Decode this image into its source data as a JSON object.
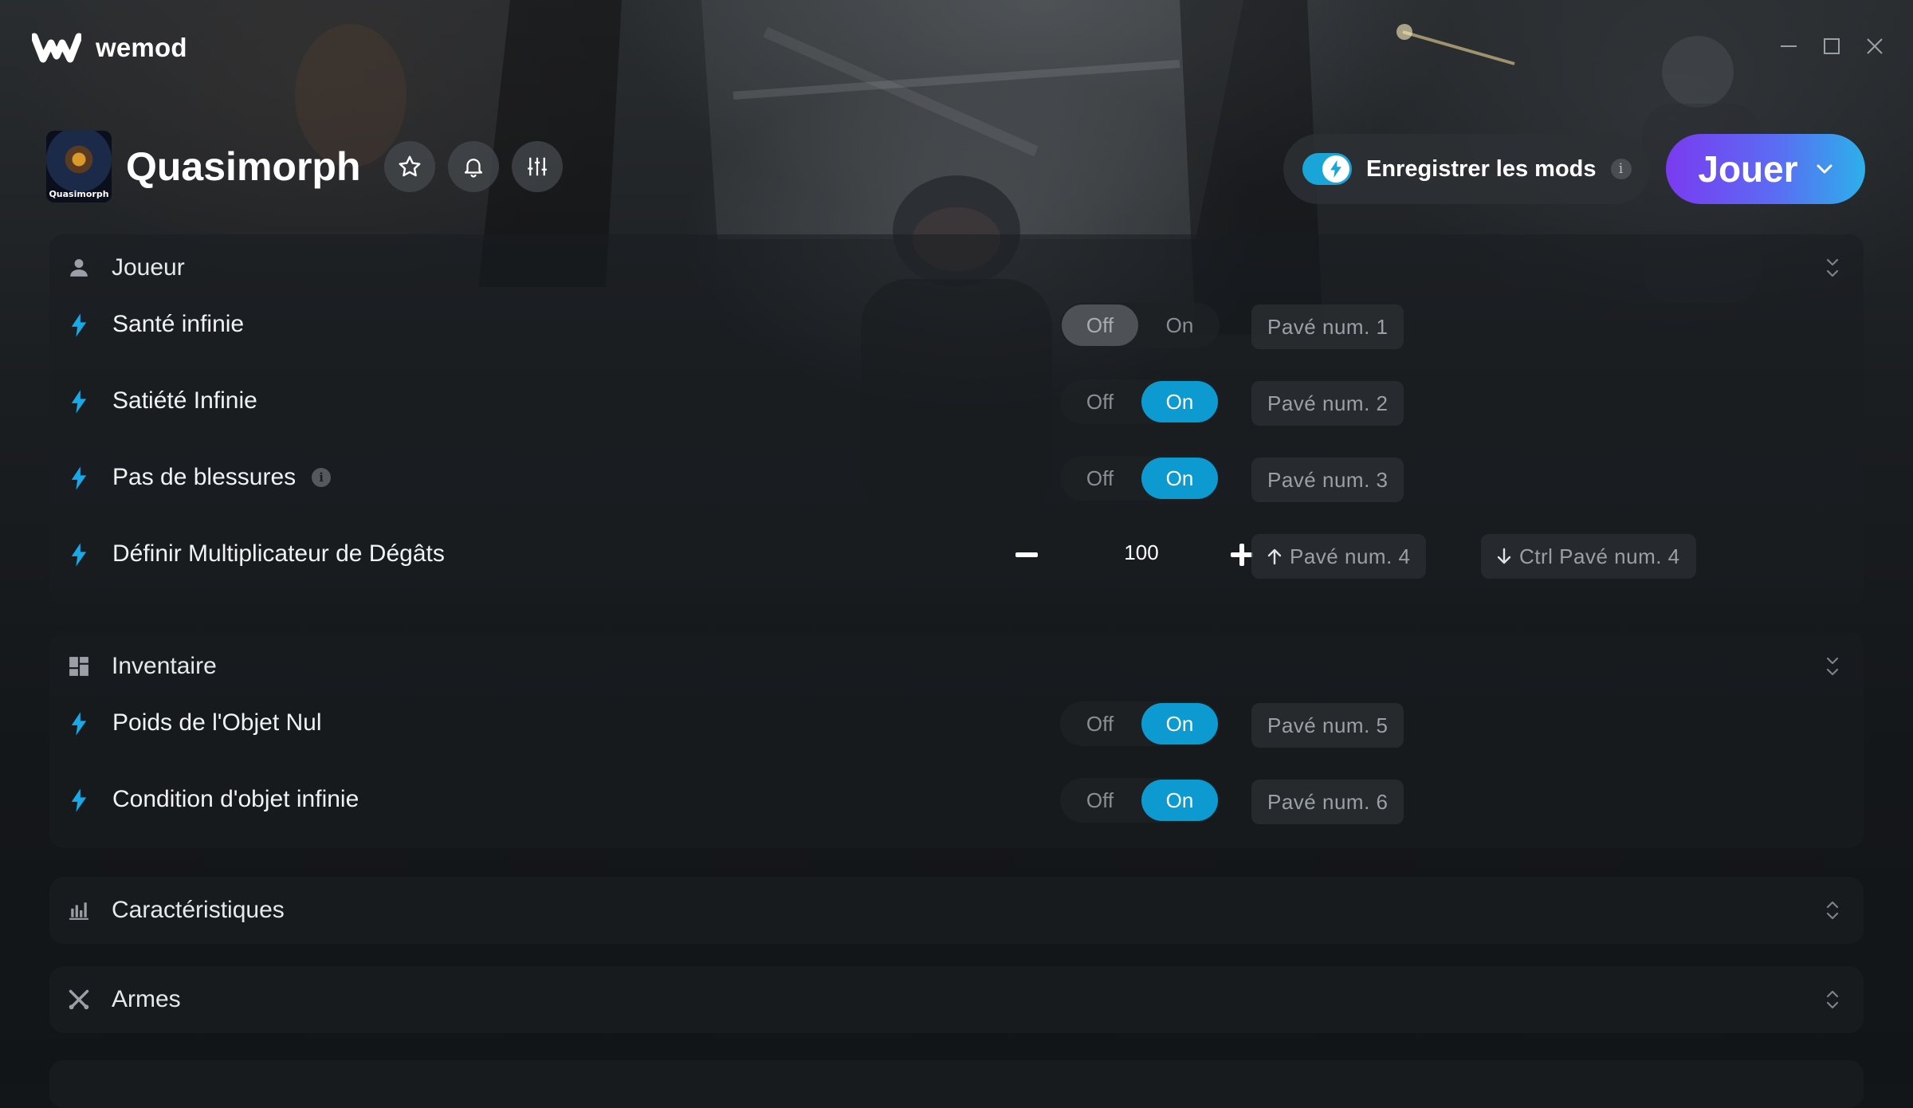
{
  "app": {
    "brand": "wemod"
  },
  "game": {
    "title": "Quasimorph",
    "thumb_label": "Quasimorph"
  },
  "header": {
    "record_label": "Enregistrer les mods",
    "record_on": true,
    "info_glyph": "i",
    "play_label": "Jouer"
  },
  "colors": {
    "accent": "#0c9ad0",
    "play_from": "#7a3bf0",
    "play_to": "#2cb0ea",
    "bolt": "#18a9e6"
  },
  "sections": {
    "joueur": {
      "title": "Joueur",
      "icon": "user-icon",
      "rows": [
        {
          "label": "Santé infinie",
          "off": "Off",
          "on": "On",
          "state": "off",
          "hotkey": "Pavé num. 1"
        },
        {
          "label": "Satiété Infinie",
          "off": "Off",
          "on": "On",
          "state": "on",
          "hotkey": "Pavé num. 2"
        },
        {
          "label": "Pas de blessures",
          "info": "i",
          "off": "Off",
          "on": "On",
          "state": "on",
          "hotkey": "Pavé num. 3"
        },
        {
          "label": "Définir Multiplicateur de Dégâts",
          "value": "100",
          "hotkey_up": "Pavé num. 4",
          "hotkey_down": "Ctrl Pavé num. 4"
        }
      ]
    },
    "inventaire": {
      "title": "Inventaire",
      "icon": "grid-icon",
      "rows": [
        {
          "label": "Poids de l'Objet Nul",
          "off": "Off",
          "on": "On",
          "state": "on",
          "hotkey": "Pavé num. 5"
        },
        {
          "label": "Condition d'objet infinie",
          "off": "Off",
          "on": "On",
          "state": "on",
          "hotkey": "Pavé num. 6"
        }
      ]
    },
    "caracteristiques": {
      "title": "Caractéristiques",
      "icon": "bar-chart-icon"
    },
    "armes": {
      "title": "Armes",
      "icon": "crossed-swords-icon"
    }
  }
}
